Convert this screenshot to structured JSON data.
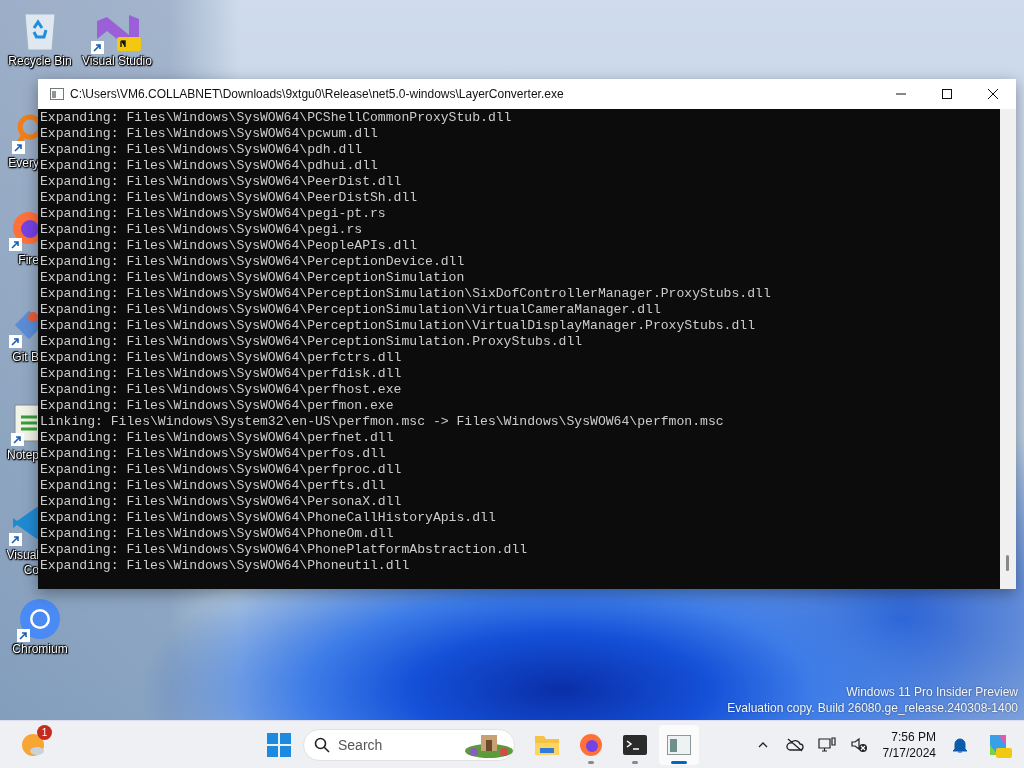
{
  "desktop": {
    "icons": [
      {
        "kind": "recycle-bin",
        "shortcut": false,
        "lines": [
          "Recycle Bin"
        ]
      },
      {
        "kind": "visual-studio",
        "shortcut": true,
        "lines": [
          "Visual Studio"
        ]
      },
      {
        "kind": "everything",
        "shortcut": true,
        "lines": [
          "Every"
        ]
      },
      {
        "kind": "firefox",
        "shortcut": true,
        "lines": [
          "Fire"
        ]
      },
      {
        "kind": "git",
        "shortcut": true,
        "lines": [
          "Git B"
        ]
      },
      {
        "kind": "notepad",
        "shortcut": true,
        "lines": [
          "Notep"
        ]
      },
      {
        "kind": "vscode",
        "shortcut": true,
        "lines": [
          "Visual",
          "Co"
        ]
      },
      {
        "kind": "chromium",
        "shortcut": true,
        "lines": [
          "Chromium"
        ]
      }
    ]
  },
  "window": {
    "title": "C:\\Users\\VM6.COLLABNET\\Downloads\\9xtgu0\\Release\\net5.0-windows\\LayerConverter.exe",
    "lines": [
      "Expanding: Files\\Windows\\SysWOW64\\PCShellCommonProxyStub.dll",
      "Expanding: Files\\Windows\\SysWOW64\\pcwum.dll",
      "Expanding: Files\\Windows\\SysWOW64\\pdh.dll",
      "Expanding: Files\\Windows\\SysWOW64\\pdhui.dll",
      "Expanding: Files\\Windows\\SysWOW64\\PeerDist.dll",
      "Expanding: Files\\Windows\\SysWOW64\\PeerDistSh.dll",
      "Expanding: Files\\Windows\\SysWOW64\\pegi-pt.rs",
      "Expanding: Files\\Windows\\SysWOW64\\pegi.rs",
      "Expanding: Files\\Windows\\SysWOW64\\PeopleAPIs.dll",
      "Expanding: Files\\Windows\\SysWOW64\\PerceptionDevice.dll",
      "Expanding: Files\\Windows\\SysWOW64\\PerceptionSimulation",
      "Expanding: Files\\Windows\\SysWOW64\\PerceptionSimulation\\SixDofControllerManager.ProxyStubs.dll",
      "Expanding: Files\\Windows\\SysWOW64\\PerceptionSimulation\\VirtualCameraManager.dll",
      "Expanding: Files\\Windows\\SysWOW64\\PerceptionSimulation\\VirtualDisplayManager.ProxyStubs.dll",
      "Expanding: Files\\Windows\\SysWOW64\\PerceptionSimulation.ProxyStubs.dll",
      "Expanding: Files\\Windows\\SysWOW64\\perfctrs.dll",
      "Expanding: Files\\Windows\\SysWOW64\\perfdisk.dll",
      "Expanding: Files\\Windows\\SysWOW64\\perfhost.exe",
      "Expanding: Files\\Windows\\SysWOW64\\perfmon.exe",
      "Linking: Files\\Windows\\System32\\en-US\\perfmon.msc -> Files\\Windows\\SysWOW64\\perfmon.msc",
      "Expanding: Files\\Windows\\SysWOW64\\perfnet.dll",
      "Expanding: Files\\Windows\\SysWOW64\\perfos.dll",
      "Expanding: Files\\Windows\\SysWOW64\\perfproc.dll",
      "Expanding: Files\\Windows\\SysWOW64\\perfts.dll",
      "Expanding: Files\\Windows\\SysWOW64\\PersonaX.dll",
      "Expanding: Files\\Windows\\SysWOW64\\PhoneCallHistoryApis.dll",
      "Expanding: Files\\Windows\\SysWOW64\\PhoneOm.dll",
      "Expanding: Files\\Windows\\SysWOW64\\PhonePlatformAbstraction.dll",
      "Expanding: Files\\Windows\\SysWOW64\\Phoneutil.dll"
    ]
  },
  "watermark": {
    "lines": [
      "Windows 11 Pro Insider Preview",
      "Evaluation copy. Build 26080.ge_release.240308-1400"
    ]
  },
  "taskbar": {
    "widget_badge": "1",
    "search": {
      "placeholder": "Search"
    },
    "apps": [
      {
        "kind": "explorer",
        "running": false,
        "selected": false
      },
      {
        "kind": "firefox",
        "running": true,
        "selected": false
      },
      {
        "kind": "terminal",
        "running": true,
        "selected": false
      },
      {
        "kind": "console-app",
        "running": true,
        "selected": true
      }
    ],
    "time": "7:56 PM",
    "date": "7/17/2024"
  }
}
